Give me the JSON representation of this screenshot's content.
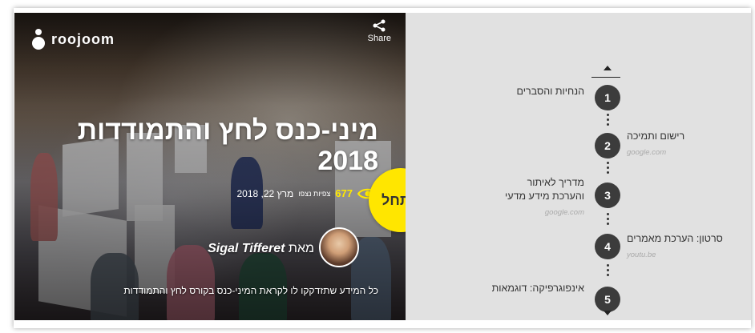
{
  "header": {
    "brand": "roojoom",
    "share_label": "Share"
  },
  "hero": {
    "title": "מיני-כנס לחץ והתמודדות 2018",
    "views": "677",
    "views_label": "צפיות נצפו",
    "date": "מרץ 22, 2018",
    "author_prefix": "מאת",
    "author_name": "Sigal Tifferet",
    "description": "כל המידע שתזדקקו לו לקראת המיני-כנס בקורס לחץ והתמודדות",
    "start_label": "התחל"
  },
  "toc": {
    "steps": [
      {
        "number": "1",
        "title": "הנחיות והסברים",
        "domain": ""
      },
      {
        "number": "2",
        "title": "רישום ותמיכה",
        "domain": "google.com"
      },
      {
        "number": "3",
        "title": "מדריך לאיתור והערכת מידע מדעי",
        "domain": "google.com"
      },
      {
        "number": "4",
        "title": "סרטון: הערכת מאמרים",
        "domain": "youtu.be"
      },
      {
        "number": "5",
        "title": "אינפוגרפיקה: דוגמאות",
        "domain": ""
      }
    ]
  },
  "colors": {
    "accent_yellow": "#ffe600",
    "step_circle": "#3c3c3c",
    "toc_background": "#e1e1e1"
  },
  "icons": [
    "share-icon",
    "eye-icon",
    "arrow-up-icon",
    "arrow-down-icon"
  ]
}
